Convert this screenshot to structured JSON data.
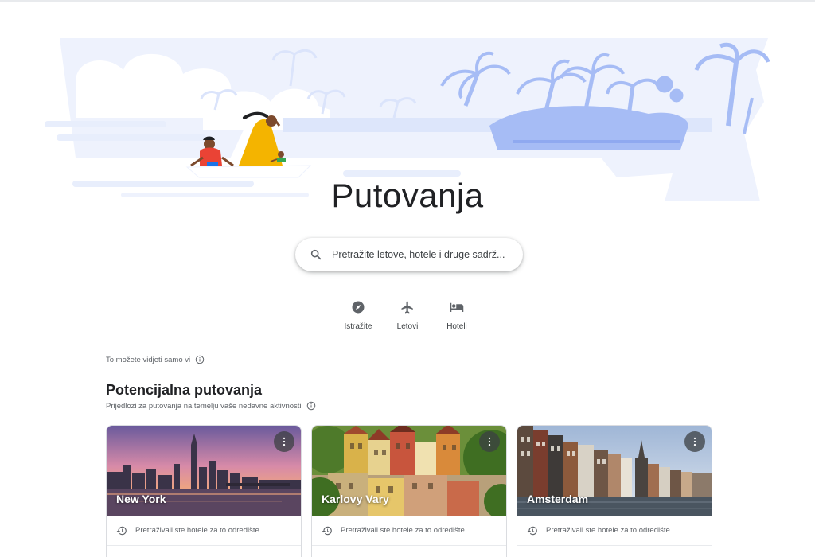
{
  "page": {
    "title": "Putovanja"
  },
  "search": {
    "placeholder": "Pretražite letove, hotele i druge sadrž..."
  },
  "nav": [
    {
      "label": "Istražite",
      "icon": "compass-icon"
    },
    {
      "label": "Letovi",
      "icon": "airplane-icon"
    },
    {
      "label": "Hoteli",
      "icon": "bed-icon"
    }
  ],
  "privacy_note": "To možete vidjeti samo vi",
  "section": {
    "title": "Potencijalna putovanja",
    "subtitle": "Prijedlozi za putovanja na temelju vaše nedavne aktivnosti"
  },
  "cards": [
    {
      "city": "New York",
      "note": "Pretraživali ste hotele za to odredište"
    },
    {
      "city": "Karlovy Vary",
      "note": "Pretraživali ste hotele za to odredište"
    },
    {
      "city": "Amsterdam",
      "note": "Pretraživali ste hotele za to odredište"
    }
  ],
  "colors": {
    "hero_light": "#e8eefc",
    "hero_mid": "#a6bcf5",
    "accent_yellow": "#f4b400",
    "accent_red": "#ea4335"
  }
}
